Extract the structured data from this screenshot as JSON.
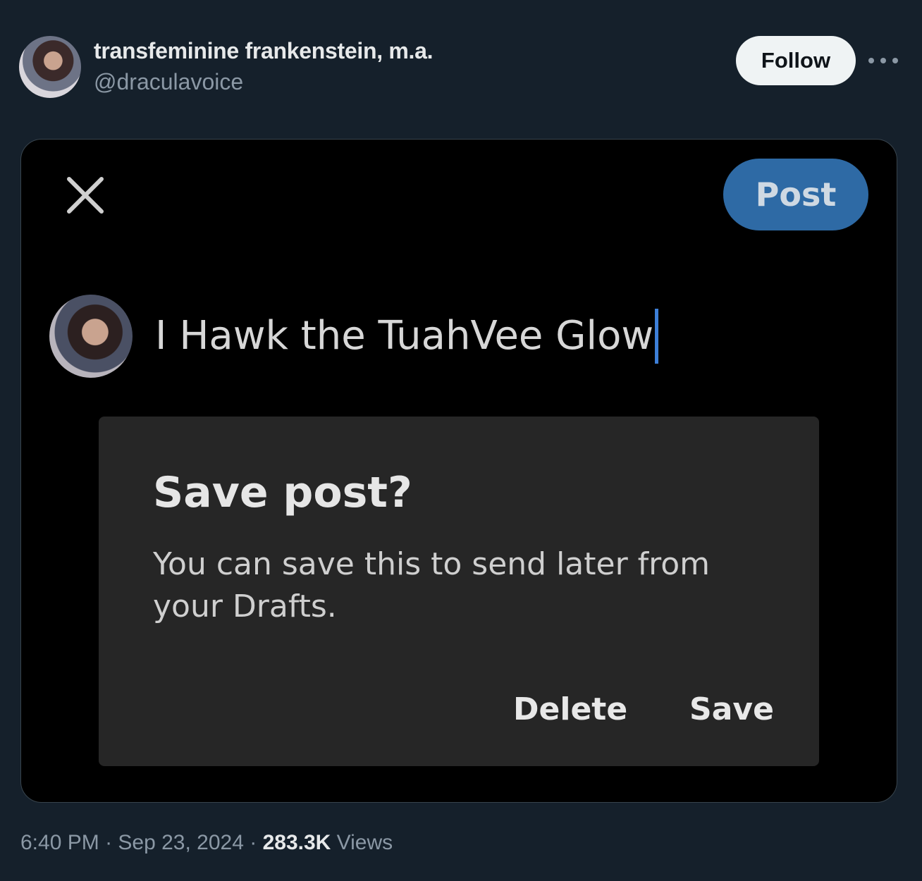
{
  "tweet": {
    "author": {
      "display_name": "transfeminine frankenstein, m.a.",
      "handle": "@draculavoice"
    },
    "follow_label": "Follow",
    "time": "6:40 PM",
    "separator": " · ",
    "date": "Sep 23, 2024",
    "views_count": "283.3K",
    "views_label": "Views"
  },
  "composer": {
    "post_label": "Post",
    "draft_text": "I Hawk the TuahVee Glow",
    "accent_color": "#2e6aa5"
  },
  "dialog": {
    "title": "Save post?",
    "body": "You can save this to send later from your Drafts.",
    "delete_label": "Delete",
    "save_label": "Save"
  },
  "icons": {
    "close": "close-icon",
    "more": "more-icon",
    "avatar": "avatar"
  }
}
